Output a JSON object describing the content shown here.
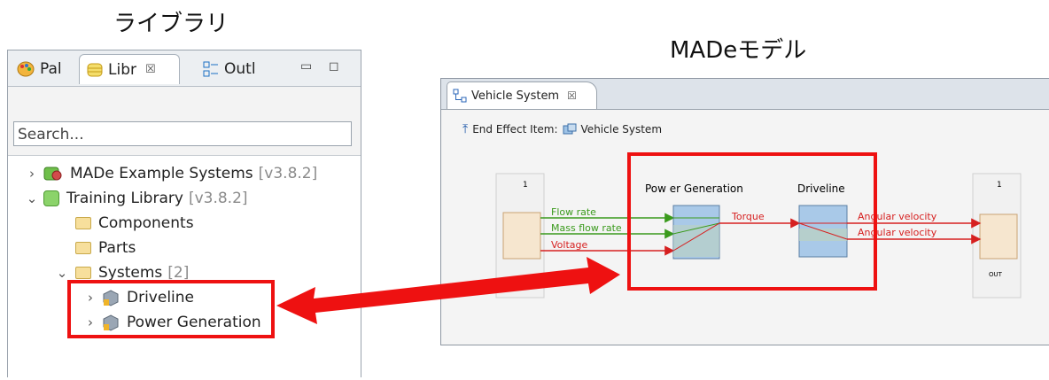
{
  "captions": {
    "library": "ライブラリ",
    "model": "MADeモデル"
  },
  "library_panel": {
    "tabs": [
      {
        "label": "Pal"
      },
      {
        "label": "Libr"
      },
      {
        "label": "Outl"
      }
    ],
    "close_glyph": "☒",
    "search_placeholder": "Search...",
    "tree": [
      {
        "label": "MADe Example Systems",
        "version": "[v3.8.2]",
        "expanded": false
      },
      {
        "label": "Training Library",
        "version": "[v3.8.2]",
        "expanded": true
      },
      {
        "label": "Components"
      },
      {
        "label": "Parts"
      },
      {
        "label": "Systems",
        "count": "[2]",
        "expanded": true
      },
      {
        "label": "Driveline"
      },
      {
        "label": "Power Generation"
      }
    ]
  },
  "model_editor": {
    "tab_title": "Vehicle System",
    "close_glyph": "☒",
    "end_effect_label": "End Effect Item:",
    "end_effect_value": "Vehicle System",
    "diagram": {
      "input_port_label": "1",
      "output_port_label": "1",
      "output_port_name": "OUT",
      "blocks": [
        {
          "name": "Pow er Generation"
        },
        {
          "name": "Driveline"
        }
      ],
      "input_flows": [
        "Flow rate",
        "Mass flow rate",
        "Voltage"
      ],
      "middle_flow": "Torque",
      "output_flows": [
        "Angular velocity",
        "Angular velocity"
      ]
    }
  },
  "colors": {
    "highlight": "#ee1111",
    "green_flow": "#3a9a1c",
    "red_flow": "#d62020",
    "block_fill": "#a9c9e8"
  }
}
